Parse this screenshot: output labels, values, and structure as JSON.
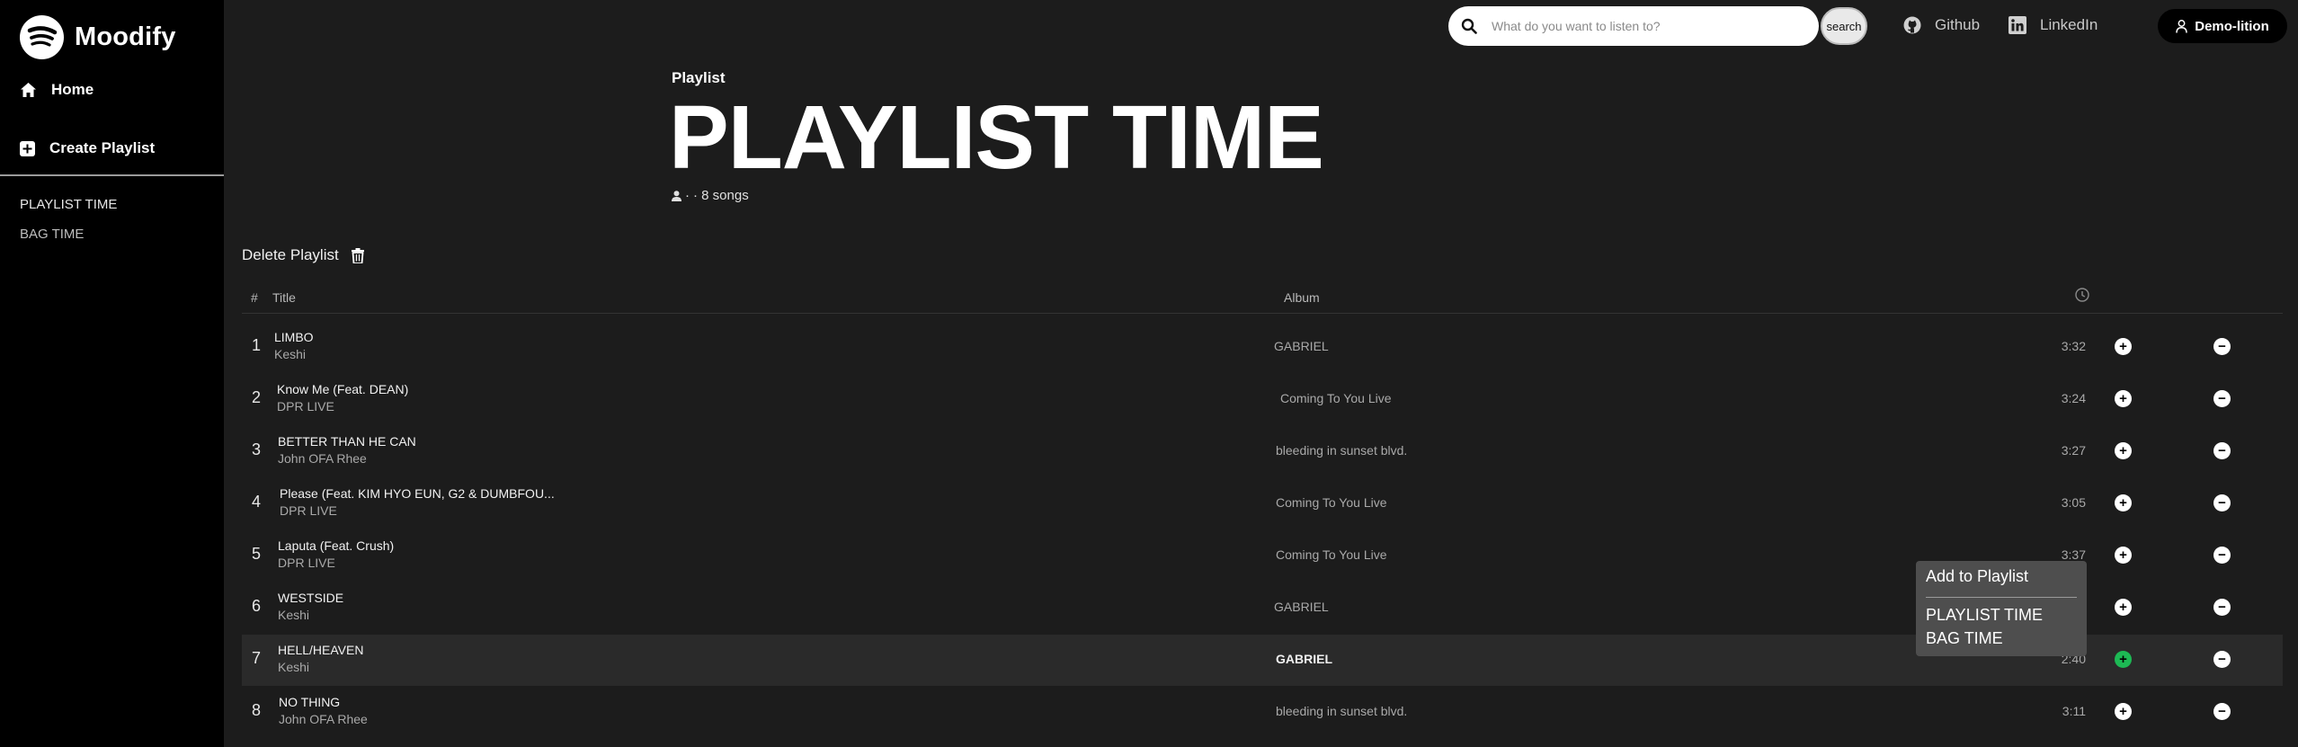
{
  "app": {
    "name": "Moodify",
    "brand_color": "#1db954"
  },
  "sidebar": {
    "home_label": "Home",
    "create_label": "Create Playlist",
    "playlists": [
      "PLAYLIST TIME",
      "BAG TIME"
    ]
  },
  "topbar": {
    "search_placeholder": "What do you want to listen to?",
    "search_button": "search",
    "github_label": "Github",
    "linkedin_label": "LinkedIn",
    "user_label": "Demo-lition"
  },
  "playlist": {
    "kicker": "Playlist",
    "title": "PLAYLIST TIME",
    "meta_dot": "·",
    "meta_songs": "· 8 songs",
    "delete_label": "Delete Playlist"
  },
  "table": {
    "headers": {
      "num": "#",
      "title": "Title",
      "album": "Album"
    },
    "rows": [
      {
        "num": "1",
        "title": "LIMBO",
        "artist": "Keshi",
        "album": "GABRIEL",
        "duration": "3:32"
      },
      {
        "num": "2",
        "title": "Know Me (Feat. DEAN)",
        "artist": "DPR LIVE",
        "album": "Coming To You Live",
        "duration": "3:24"
      },
      {
        "num": "3",
        "title": "BETTER THAN HE CAN",
        "artist": "John OFA Rhee",
        "album": "bleeding in sunset blvd.",
        "duration": "3:27"
      },
      {
        "num": "4",
        "title": "Please (Feat. KIM HYO EUN, G2 & DUMBFOU...",
        "artist": "DPR LIVE",
        "album": "Coming To You Live",
        "duration": "3:05"
      },
      {
        "num": "5",
        "title": "Laputa (Feat. Crush)",
        "artist": "DPR LIVE",
        "album": "Coming To You Live",
        "duration": "3:37"
      },
      {
        "num": "6",
        "title": "WESTSIDE",
        "artist": "Keshi",
        "album": "GABRIEL",
        "duration": ""
      },
      {
        "num": "7",
        "title": "HELL/HEAVEN",
        "artist": "Keshi",
        "album": "GABRIEL",
        "duration": "2:40"
      },
      {
        "num": "8",
        "title": "NO THING",
        "artist": "John OFA Rhee",
        "album": "bleeding in sunset blvd.",
        "duration": "3:11"
      }
    ]
  },
  "context_menu": {
    "title": "Add to Playlist",
    "items": [
      "PLAYLIST TIME",
      "BAG TIME"
    ]
  }
}
